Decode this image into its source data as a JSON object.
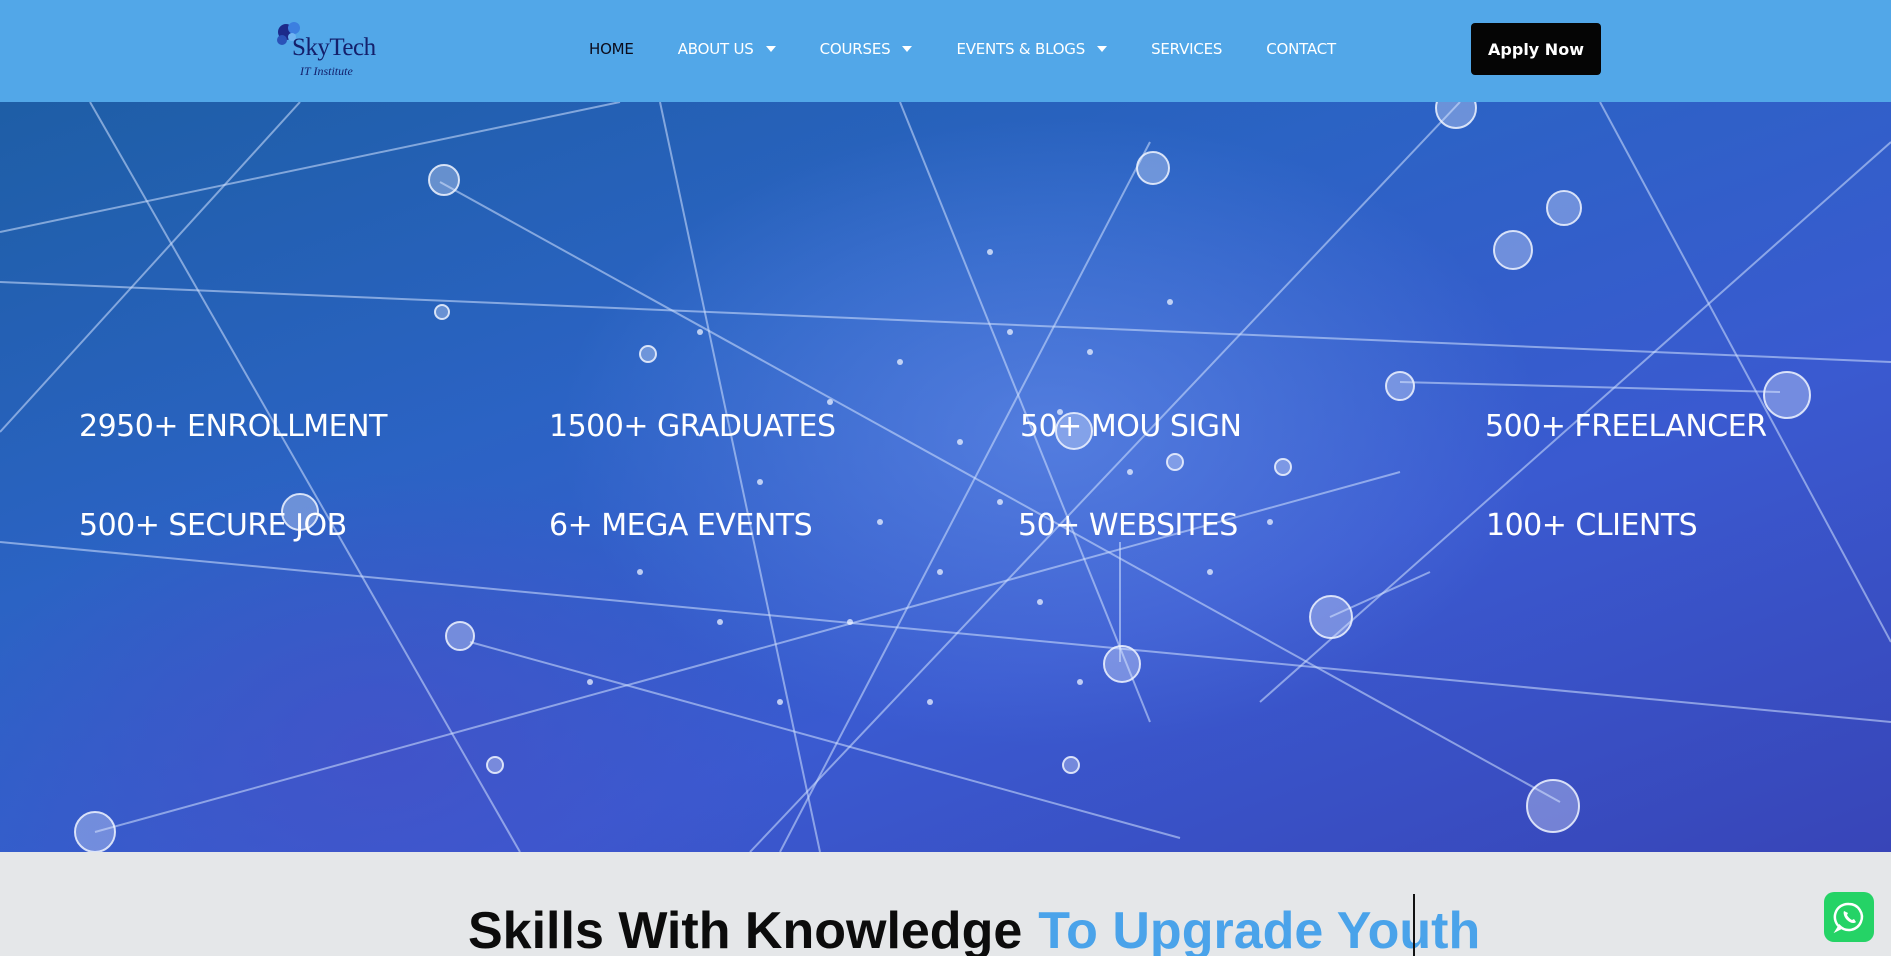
{
  "brand": {
    "name": "SkyTech",
    "subtitle": "IT Institute"
  },
  "nav": {
    "items": [
      {
        "label": "HOME",
        "dropdown": false,
        "active": true
      },
      {
        "label": "ABOUT US",
        "dropdown": true,
        "active": false
      },
      {
        "label": "COURSES",
        "dropdown": true,
        "active": false
      },
      {
        "label": "EVENTS & BLOGS",
        "dropdown": true,
        "active": false
      },
      {
        "label": "SERVICES",
        "dropdown": false,
        "active": false
      },
      {
        "label": "CONTACT",
        "dropdown": false,
        "active": false
      }
    ],
    "apply_label": "Apply Now"
  },
  "hero": {
    "stats": [
      "2950+ ENROLLMENT",
      "1500+ GRADUATES",
      "50+ MOU SIGN",
      "500+ FREELANCER",
      "500+ SECURE JOB",
      "6+ MEGA EVENTS",
      "50+ WEBSITES",
      "100+ CLIENTS"
    ]
  },
  "tagline": {
    "part1": "Skills With Knowledge",
    "part2": "To Upgrade Youth"
  },
  "icons": {
    "whatsapp": "whatsapp-icon",
    "caret": "chevron-down-icon",
    "network_node": "user-icon"
  },
  "colors": {
    "header": "#52a7e8",
    "apply_button": "#050505",
    "tagline_accent": "#4aa3ea",
    "whatsapp": "#25d366",
    "section_bg": "#e5e7e9"
  }
}
